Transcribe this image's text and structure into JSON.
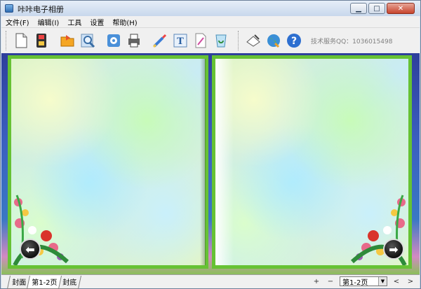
{
  "window": {
    "title": "咔咔电子相册",
    "minimize_label": "▁",
    "maximize_label": "□",
    "close_label": "✕"
  },
  "menu": {
    "items": [
      "文件(F)",
      "编辑(I)",
      "工具",
      "设置",
      "帮助(H)"
    ]
  },
  "toolbar": {
    "tools": [
      "new-document-icon",
      "save-icon",
      "open-folder-icon",
      "search-icon",
      "settings-icon",
      "print-icon",
      "paint-brush-icon",
      "text-icon",
      "document-edit-icon",
      "refresh-icon",
      "clipboard-icon",
      "globe-icon",
      "help-icon"
    ],
    "service_text": "技术服务QQ：1036015498"
  },
  "album": {
    "prev_arrow": "⬅",
    "next_arrow": "➡",
    "colors": {
      "page_border": "#66c234",
      "background_top": "#2e3f9c"
    }
  },
  "bottom": {
    "tabs": [
      "封面",
      "第1-2页",
      "封底"
    ],
    "active_tab_index": 1,
    "zoom_in": "+",
    "zoom_out": "−",
    "page_value": "第1-2页",
    "prev_page": "<",
    "next_page": ">"
  }
}
